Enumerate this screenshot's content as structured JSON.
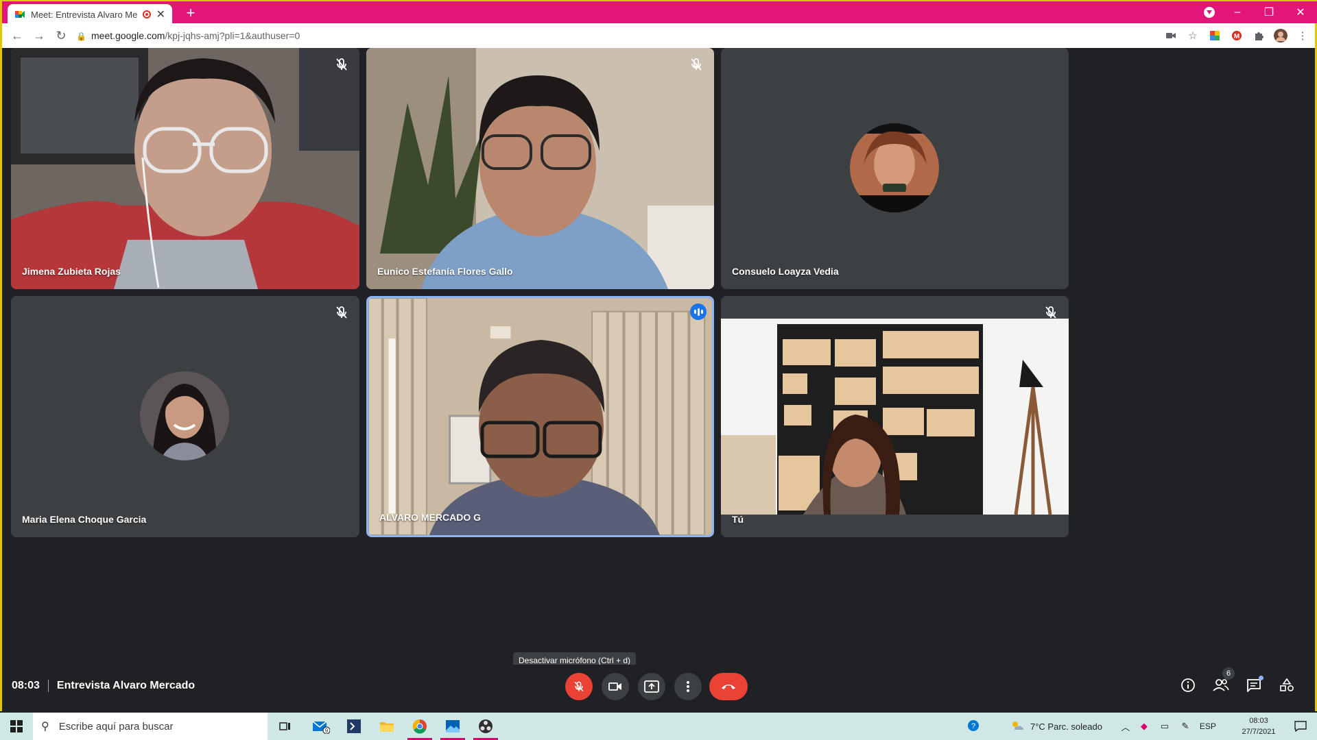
{
  "browser": {
    "tab_title": "Meet: Entrevista Alvaro Merc",
    "url_host": "meet.google.com",
    "url_path": "/kpj-jqhs-amj?pli=1&authuser=0"
  },
  "participants": [
    {
      "name": "Jimena Zubieta Rojas",
      "muted": true
    },
    {
      "name": "Eunico Estefanía Flores Gallo",
      "muted": true
    },
    {
      "name": "Consuelo Loayza Vedia",
      "muted": false
    },
    {
      "name": "Maria Elena Choque Garcia",
      "muted": true
    },
    {
      "name": "ALVARO MERCADO G",
      "speaking": true
    },
    {
      "name": "Tú",
      "muted": true
    }
  ],
  "meeting": {
    "time": "08:03",
    "title": "Entrevista Alvaro Mercado",
    "tooltip": "Desactivar micrófono (Ctrl + d)",
    "people_count": "6"
  },
  "taskbar": {
    "search_placeholder": "Escribe aquí para buscar",
    "mail_badge": "9",
    "weather": "7°C  Parc. soleado",
    "lang": "ESP",
    "clock_time": "08:03",
    "clock_date": "27/7/2021"
  },
  "colors": {
    "chrome_frame": "#e2157a",
    "meet_bg": "#202124",
    "tile_bg": "#3c4043",
    "hangup": "#ea4335",
    "speaking": "#1a73e8"
  }
}
